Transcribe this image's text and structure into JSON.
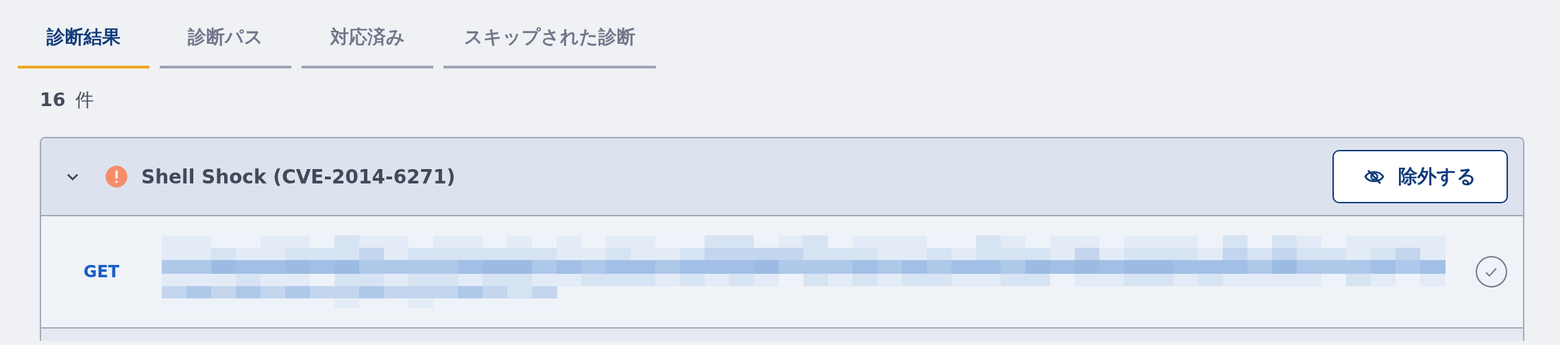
{
  "tabs": [
    {
      "label": "診断結果",
      "selected": true
    },
    {
      "label": "診断パス",
      "selected": false
    },
    {
      "label": "対応済み",
      "selected": false
    },
    {
      "label": "スキップされた診断",
      "selected": false
    }
  ],
  "result_count": {
    "number": "16",
    "unit": "件"
  },
  "findings": [
    {
      "title": "Shell Shock (CVE-2014-6271)",
      "expanded": true,
      "color": "#f58d6b",
      "exclude_button": "除外する",
      "requests": [
        {
          "method": "GET",
          "resolved": false
        }
      ]
    }
  ]
}
